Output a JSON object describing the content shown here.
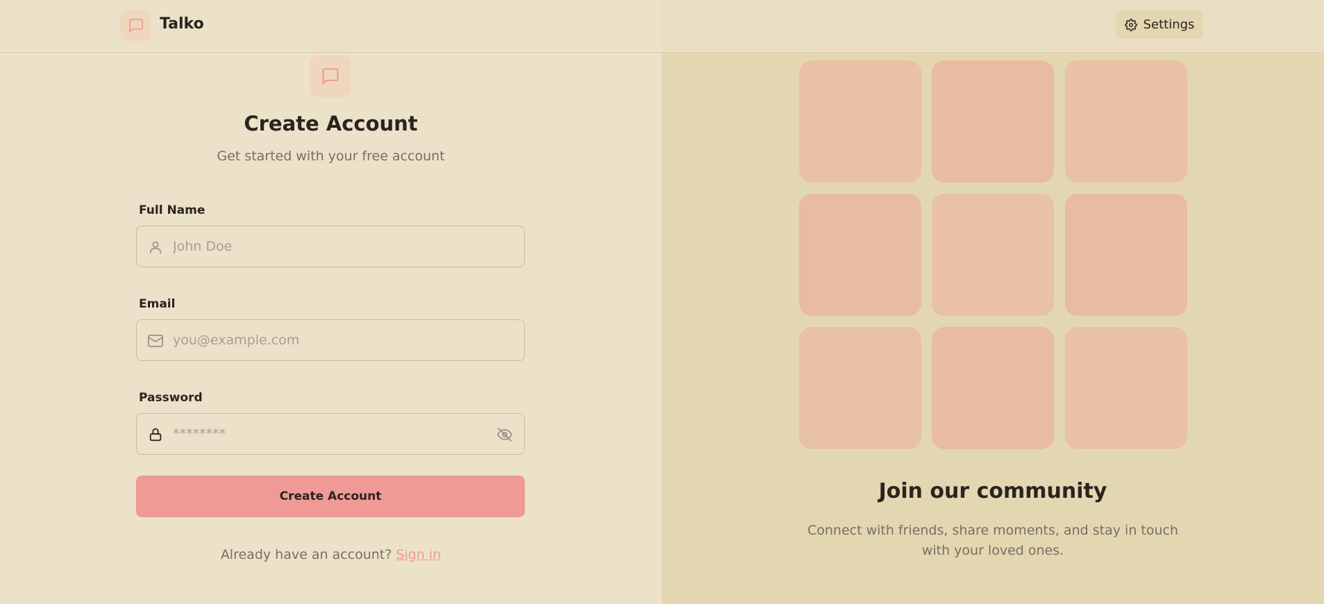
{
  "header": {
    "brand_name": "Talko",
    "settings_label": "Settings",
    "brand_icon": "message-square-icon",
    "settings_icon": "gear-icon"
  },
  "form": {
    "icon": "message-square-icon",
    "title": "Create Account",
    "subtitle": "Get started with your free account",
    "full_name": {
      "label": "Full Name",
      "placeholder": "John Doe",
      "value": "",
      "icon": "user-icon"
    },
    "email": {
      "label": "Email",
      "placeholder": "you@example.com",
      "value": "",
      "icon": "mail-icon"
    },
    "password": {
      "label": "Password",
      "placeholder": "********",
      "value": "",
      "icon": "lock-icon",
      "toggle_icon": "eye-off-icon"
    },
    "submit_label": "Create Account",
    "signin_prompt": "Already have an account?",
    "signin_link": "Sign in"
  },
  "community": {
    "title": "Join our community",
    "text": "Connect with friends, share moments, and stay in touch with your loved ones."
  },
  "colors": {
    "background": "#ece2c9",
    "panel": "#e3d7b2",
    "accent": "#ef9a94",
    "tile": "#e8bba3",
    "muted_text": "#7a6d62"
  }
}
